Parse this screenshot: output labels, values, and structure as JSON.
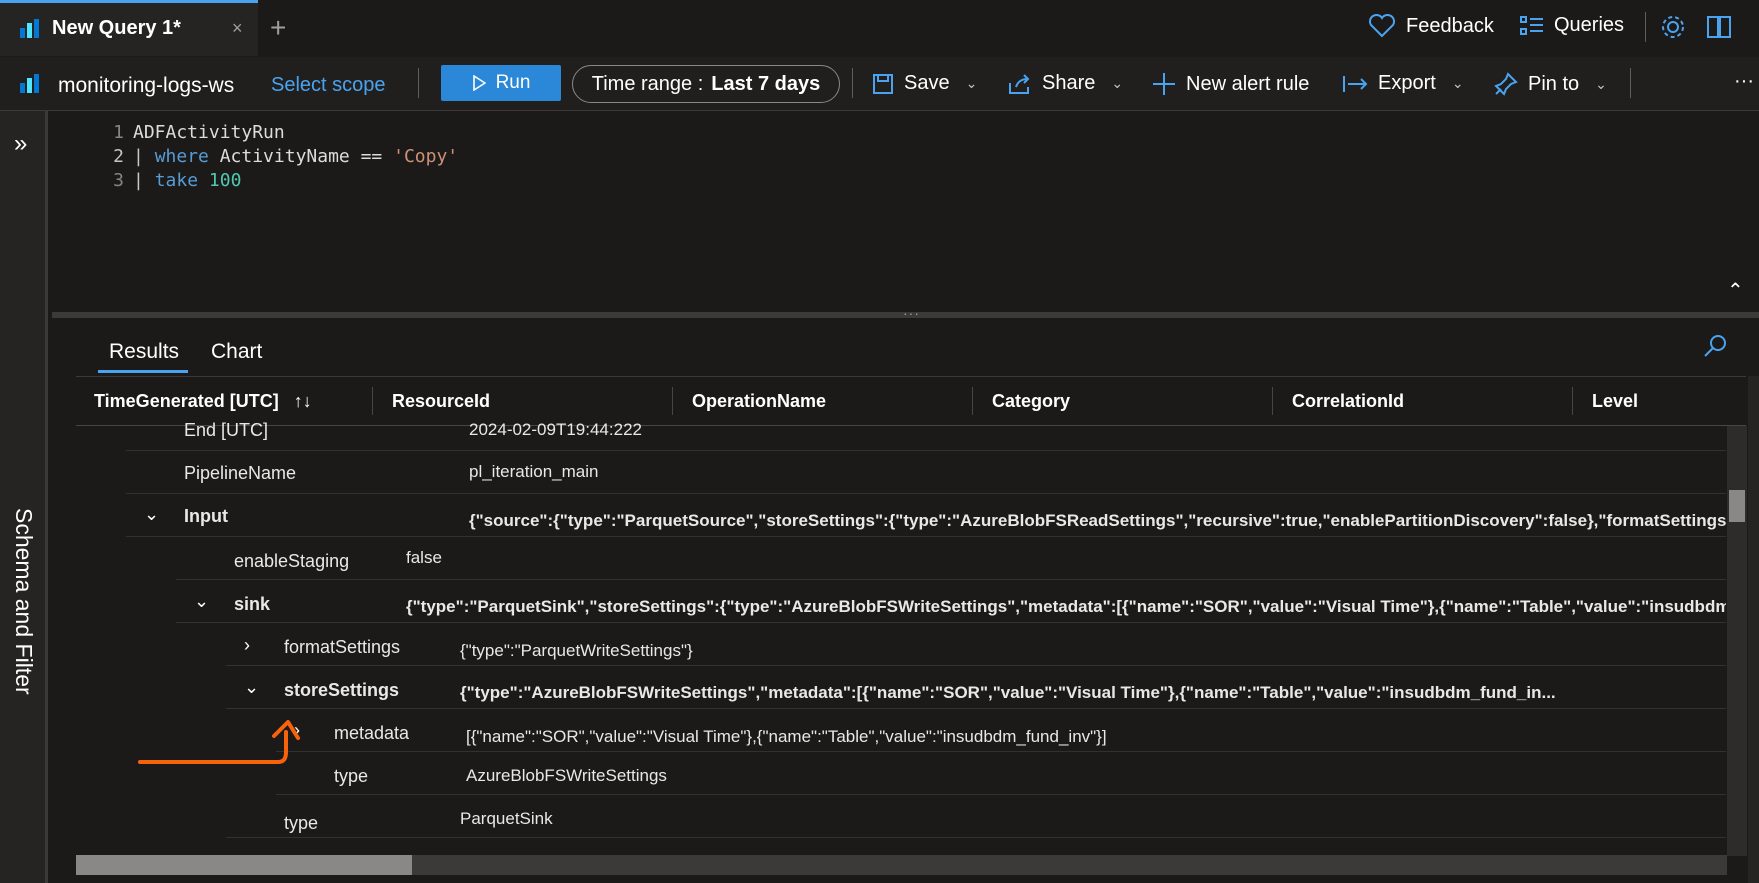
{
  "tab": {
    "title": "New Query 1*",
    "close": "×",
    "add": "+"
  },
  "top_links": {
    "feedback": "Feedback",
    "queries": "Queries"
  },
  "toolbar": {
    "workspace": "monitoring-logs-ws",
    "select_scope": "Select scope",
    "run": "Run",
    "time_range_label": "Time range :",
    "time_range_value": "Last 7 days",
    "save": "Save",
    "share": "Share",
    "new_alert_rule": "New alert rule",
    "export": "Export",
    "pin_to": "Pin to",
    "more": "···"
  },
  "left_rail": {
    "label": "Schema and Filter"
  },
  "editor": {
    "line_numbers": [
      "1",
      "2",
      "3"
    ],
    "line1": "ADFActivityRun",
    "line2_pipe": "|",
    "line2_kw": "where",
    "line2_mid": " ActivityName == ",
    "line2_str": "'Copy'",
    "line3_pipe": "|",
    "line3_kw": "take",
    "line3_num": "100"
  },
  "results": {
    "tabs": [
      "Results",
      "Chart"
    ],
    "columns": [
      "TimeGenerated [UTC]",
      "ResourceId",
      "OperationName",
      "Category",
      "CorrelationId",
      "Level"
    ],
    "sort_icon": "↑↓",
    "rows": [
      {
        "key": "End [UTC]",
        "value": "2024-02-09T19:44:222"
      },
      {
        "key": "PipelineName",
        "value": "pl_iteration_main"
      },
      {
        "key": "Input",
        "value": "{\"source\":{\"type\":\"ParquetSource\",\"storeSettings\":{\"type\":\"AzureBlobFSReadSettings\",\"recursive\":true,\"enablePartitionDiscovery\":false},\"formatSettings\":{\"t"
      },
      {
        "key": "enableStaging",
        "value": "false"
      },
      {
        "key": "sink",
        "value": "{\"type\":\"ParquetSink\",\"storeSettings\":{\"type\":\"AzureBlobFSWriteSettings\",\"metadata\":[{\"name\":\"SOR\",\"value\":\"Visual Time\"},{\"name\":\"Table\",\"value\":\"insudbdm_fu"
      },
      {
        "key": "formatSettings",
        "value": "{\"type\":\"ParquetWriteSettings\"}"
      },
      {
        "key": "storeSettings",
        "value": "{\"type\":\"AzureBlobFSWriteSettings\",\"metadata\":[{\"name\":\"SOR\",\"value\":\"Visual Time\"},{\"name\":\"Table\",\"value\":\"insudbdm_fund_in..."
      },
      {
        "key": "metadata",
        "value": "[{\"name\":\"SOR\",\"value\":\"Visual Time\"},{\"name\":\"Table\",\"value\":\"insudbdm_fund_inv\"}]"
      },
      {
        "key": "type",
        "value": "AzureBlobFSWriteSettings"
      },
      {
        "key": "type",
        "value": "ParquetSink"
      }
    ]
  },
  "colors": {
    "accent": "#4aa3f0",
    "run_button": "#2b88d8",
    "annotation_arrow": "#f7630c"
  }
}
